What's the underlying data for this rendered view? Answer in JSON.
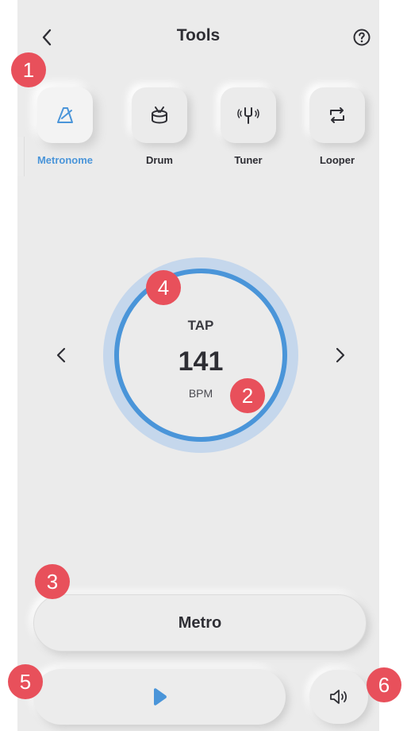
{
  "header": {
    "title": "Tools",
    "back_icon": "chevron-left-icon",
    "help_icon": "help-circle-icon"
  },
  "tools": [
    {
      "label": "Metronome",
      "icon": "metronome-icon",
      "active": true
    },
    {
      "label": "Drum",
      "icon": "drum-icon",
      "active": false
    },
    {
      "label": "Tuner",
      "icon": "tuning-fork-icon",
      "active": false
    },
    {
      "label": "Looper",
      "icon": "loop-icon",
      "active": false
    }
  ],
  "dial": {
    "tap_label": "TAP",
    "bpm": "141",
    "unit": "BPM"
  },
  "mode": {
    "label": "Metro"
  },
  "controls": {
    "play_icon": "play-icon",
    "sound_icon": "speaker-icon"
  },
  "markers": [
    "1",
    "2",
    "3",
    "4",
    "5",
    "6"
  ],
  "colors": {
    "accent": "#4a95d9",
    "ring": "#c5d7ec",
    "background": "#ebebeb",
    "marker": "#e8505b"
  }
}
